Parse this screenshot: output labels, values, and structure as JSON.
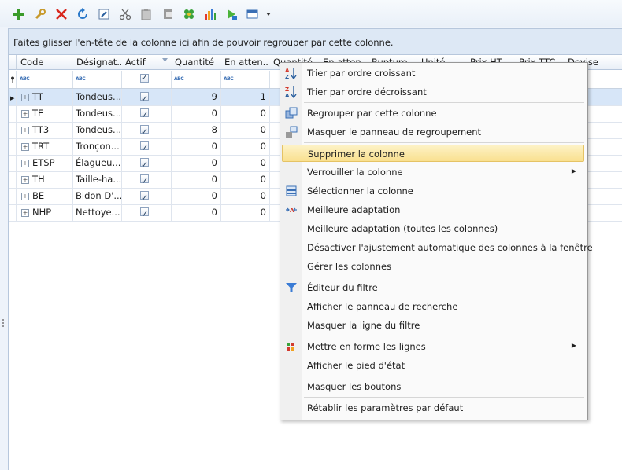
{
  "toolbar": {
    "icons": [
      "add-icon",
      "wrench-icon",
      "delete-icon",
      "refresh-icon",
      "edit-icon",
      "cut-icon",
      "paste-icon",
      "export-icon",
      "flower-icon",
      "chart-icon",
      "run-icon",
      "settings-icon"
    ]
  },
  "group_panel": {
    "text": "Faites glisser l'en-tête de la colonne ici afin de pouvoir regrouper par cette colonne."
  },
  "columns": [
    {
      "key": "code",
      "label": "Code"
    },
    {
      "key": "designation",
      "label": "Désignat..."
    },
    {
      "key": "actif",
      "label": "Actif"
    },
    {
      "key": "quantite",
      "label": "Quantité"
    },
    {
      "key": "en_attente",
      "label": "En atten..."
    },
    {
      "key": "quantite2",
      "label": "Quantité..."
    },
    {
      "key": "en_atten2",
      "label": "En atten..."
    },
    {
      "key": "rupture",
      "label": "Rupture..."
    },
    {
      "key": "unite",
      "label": "Unité..."
    },
    {
      "key": "prix_ht",
      "label": "Prix HT..."
    },
    {
      "key": "prix_ttc",
      "label": "Prix TTC..."
    },
    {
      "key": "devise",
      "label": "Devise"
    }
  ],
  "filter_placeholder": "ABC",
  "rows": [
    {
      "code": "TT",
      "designation": "Tondeus...",
      "actif": true,
      "quantite": "9",
      "en_attente": "1"
    },
    {
      "code": "TE",
      "designation": "Tondeus...",
      "actif": true,
      "quantite": "0",
      "en_attente": "0"
    },
    {
      "code": "TT3",
      "designation": "Tondeus...",
      "actif": true,
      "quantite": "8",
      "en_attente": "0"
    },
    {
      "code": "TRT",
      "designation": "Tronçon...",
      "actif": true,
      "quantite": "0",
      "en_attente": "0"
    },
    {
      "code": "ETSP",
      "designation": "Élagueu...",
      "actif": true,
      "quantite": "0",
      "en_attente": "0"
    },
    {
      "code": "TH",
      "designation": "Taille-ha...",
      "actif": true,
      "quantite": "0",
      "en_attente": "0"
    },
    {
      "code": "BE",
      "designation": "Bidon D'...",
      "actif": true,
      "quantite": "0",
      "en_attente": "0"
    },
    {
      "code": "NHP",
      "designation": "Nettoye...",
      "actif": true,
      "quantite": "0",
      "en_attente": "0"
    }
  ],
  "menu": {
    "items": [
      {
        "label": "Trier par ordre croissant",
        "icon": "sort-ascending-icon"
      },
      {
        "label": "Trier par ordre décroissant",
        "icon": "sort-descending-icon"
      },
      {
        "label": "Regrouper par cette colonne",
        "icon": "group-by-column-icon"
      },
      {
        "label": "Masquer le panneau de regroupement",
        "icon": "hide-group-panel-icon"
      },
      {
        "label": "Supprimer la colonne",
        "icon": ""
      },
      {
        "label": "Verrouiller la colonne",
        "icon": "",
        "submenu": true
      },
      {
        "label": "Sélectionner la colonne",
        "icon": "select-column-icon"
      },
      {
        "label": "Meilleure adaptation",
        "icon": "best-fit-icon"
      },
      {
        "label": "Meilleure adaptation (toutes les colonnes)",
        "icon": ""
      },
      {
        "label": "Désactiver l'ajustement automatique des colonnes à la fenêtre",
        "icon": ""
      },
      {
        "label": "Gérer les colonnes",
        "icon": ""
      },
      {
        "label": "Éditeur du filtre",
        "icon": "filter-icon"
      },
      {
        "label": "Afficher le panneau de recherche",
        "icon": ""
      },
      {
        "label": "Masquer la ligne du filtre",
        "icon": ""
      },
      {
        "label": "Mettre en forme les lignes",
        "icon": "format-rows-icon",
        "submenu": true
      },
      {
        "label": "Afficher le pied d'état",
        "icon": ""
      },
      {
        "label": "Masquer les boutons",
        "icon": ""
      },
      {
        "label": "Rétablir les paramètres par défaut",
        "icon": ""
      }
    ],
    "highlighted": "Supprimer la colonne"
  },
  "colors": {
    "accent": "#3a6fb5",
    "highlight": "#f9e08f",
    "selected_row": "#d7e6f8"
  }
}
